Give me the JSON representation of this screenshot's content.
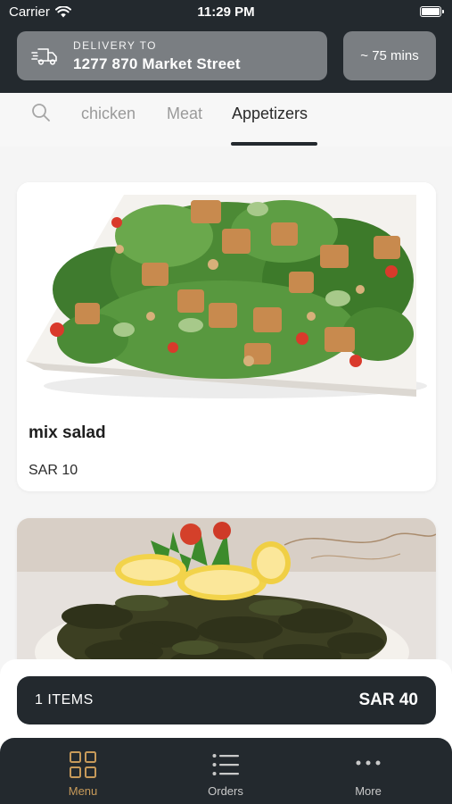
{
  "status_bar": {
    "carrier": "Carrier",
    "time": "11:29 PM"
  },
  "delivery": {
    "label": "DELIVERY TO",
    "address": "1277 870 Market Street",
    "icon": "delivery-truck-icon"
  },
  "eta": {
    "text": "~ 75 mins"
  },
  "categories": [
    {
      "label": "chicken",
      "active": false
    },
    {
      "label": "Meat",
      "active": false
    },
    {
      "label": "Appetizers",
      "active": true
    }
  ],
  "products": [
    {
      "name": "mix salad",
      "price": "SAR 10"
    },
    {
      "name": "",
      "price": ""
    }
  ],
  "cart": {
    "count_label": "1 ITEMS",
    "total": "SAR 40"
  },
  "tabbar": [
    {
      "label": "Menu",
      "icon": "grid-icon",
      "active": true
    },
    {
      "label": "Orders",
      "icon": "list-icon",
      "active": false
    },
    {
      "label": "More",
      "icon": "more-dots-icon",
      "active": false
    }
  ],
  "colors": {
    "header": "#23292e",
    "pill": "#7a7e82",
    "accent": "#c79a5a"
  }
}
